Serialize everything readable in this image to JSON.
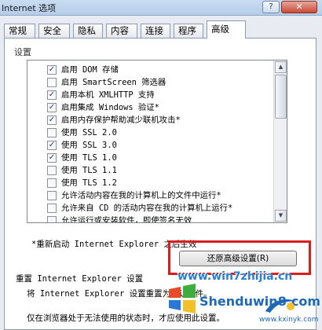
{
  "window": {
    "title": "Internet 选项",
    "help_label": "?",
    "close_label": "✕"
  },
  "tabs": [
    {
      "label": "常规",
      "active": false
    },
    {
      "label": "安全",
      "active": false
    },
    {
      "label": "隐私",
      "active": false
    },
    {
      "label": "内容",
      "active": false
    },
    {
      "label": "连接",
      "active": false
    },
    {
      "label": "程序",
      "active": false
    },
    {
      "label": "高级",
      "active": true
    }
  ],
  "settings": {
    "group_label": "设置",
    "items": [
      {
        "label": "启用 DOM 存储",
        "checked": true
      },
      {
        "label": "启用 SmartScreen 筛选器",
        "checked": false
      },
      {
        "label": "启用本机 XMLHTTP 支持",
        "checked": true
      },
      {
        "label": "启用集成 Windows 验证*",
        "checked": true
      },
      {
        "label": "启用内存保护帮助减少联机攻击*",
        "checked": true
      },
      {
        "label": "使用 SSL 2.0",
        "checked": false
      },
      {
        "label": "使用 SSL 3.0",
        "checked": true
      },
      {
        "label": "使用 TLS 1.0",
        "checked": true
      },
      {
        "label": "使用 TLS 1.1",
        "checked": false
      },
      {
        "label": "使用 TLS 1.2",
        "checked": false
      },
      {
        "label": "允许活动内容在我的计算机上的文件中运行*",
        "checked": false
      },
      {
        "label": "允许来自 CD 的活动内容在我的计算机上运行*",
        "checked": false
      },
      {
        "label": "允许运行或安装软件，即使签名无效",
        "checked": false
      }
    ],
    "restart_note": "*重新启动 Internet Explorer 之后生效",
    "restore_button": "还原高级设置(R)"
  },
  "reset": {
    "heading": "重置 Internet Explorer 设置",
    "description": "将 Internet Explorer 设置重置为默认条件。",
    "description2": "仅在浏览器处于无法使用的状态时，才应使用此设置。"
  },
  "watermark": {
    "url": "www.win7zhijia.cn",
    "brand": "Shenduwin8.com",
    "site": "www.kxinyk.com",
    "colors": {
      "blue": "#1e68b8",
      "highlight": "#d81e1e"
    }
  }
}
